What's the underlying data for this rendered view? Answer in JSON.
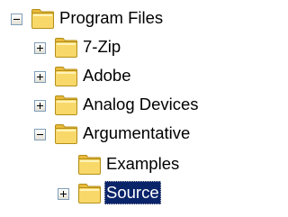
{
  "tree": {
    "nodes": [
      {
        "label": "Program Files",
        "expander": "minus",
        "icon": "folder-icon"
      },
      {
        "label": "7-Zip",
        "expander": "plus",
        "icon": "folder-icon"
      },
      {
        "label": "Adobe",
        "expander": "plus",
        "icon": "folder-icon"
      },
      {
        "label": "Analog Devices",
        "expander": "plus",
        "icon": "folder-icon"
      },
      {
        "label": "Argumentative",
        "expander": "minus",
        "icon": "folder-icon"
      },
      {
        "label": "Examples",
        "expander": "none",
        "icon": "folder-icon"
      },
      {
        "label": "Source",
        "expander": "plus",
        "icon": "folder-icon",
        "selected": true
      }
    ]
  },
  "colors": {
    "selection_bg": "#0a246a",
    "selection_text": "#ffffff",
    "folder_fill": "#f9d86a",
    "folder_outline": "#b38f18",
    "expander_border": "#7f9db9"
  }
}
